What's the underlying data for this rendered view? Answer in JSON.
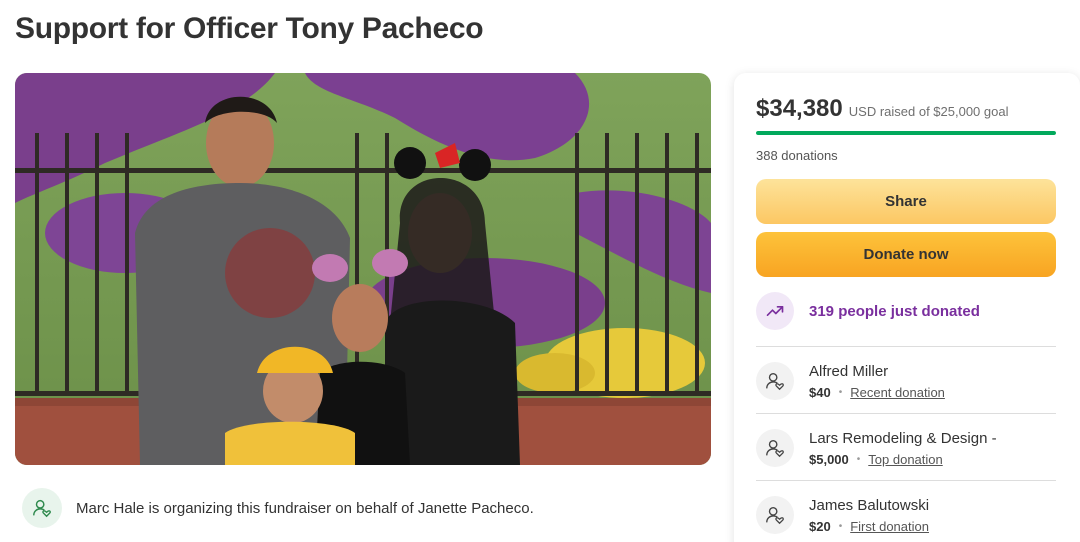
{
  "page": {
    "title": "Support for Officer Tony Pacheco"
  },
  "hero": {
    "image_icon": "family-photo"
  },
  "organizer": {
    "text": "Marc Hale is organizing this fundraiser on behalf of Janette Pacheco."
  },
  "summary": {
    "raised": "$34,380",
    "goal_text": "USD raised of $25,000 goal",
    "progress_fraction": 1.0,
    "donations": "388 donations"
  },
  "actions": {
    "share_label": "Share",
    "donate_label": "Donate now"
  },
  "trending": {
    "text": "319 people just donated"
  },
  "donors": [
    {
      "name": "Alfred Miller",
      "amount": "$40",
      "tag": "Recent donation"
    },
    {
      "name": "Lars Remodeling & Design -",
      "amount": "$5,000",
      "tag": "Top donation"
    },
    {
      "name": "James Balutowski",
      "amount": "$20",
      "tag": "First donation"
    }
  ],
  "colors": {
    "progress": "#02a95c",
    "share": "#fcd37a",
    "donate": "#fbb530",
    "trending": "#7a2f9e"
  }
}
